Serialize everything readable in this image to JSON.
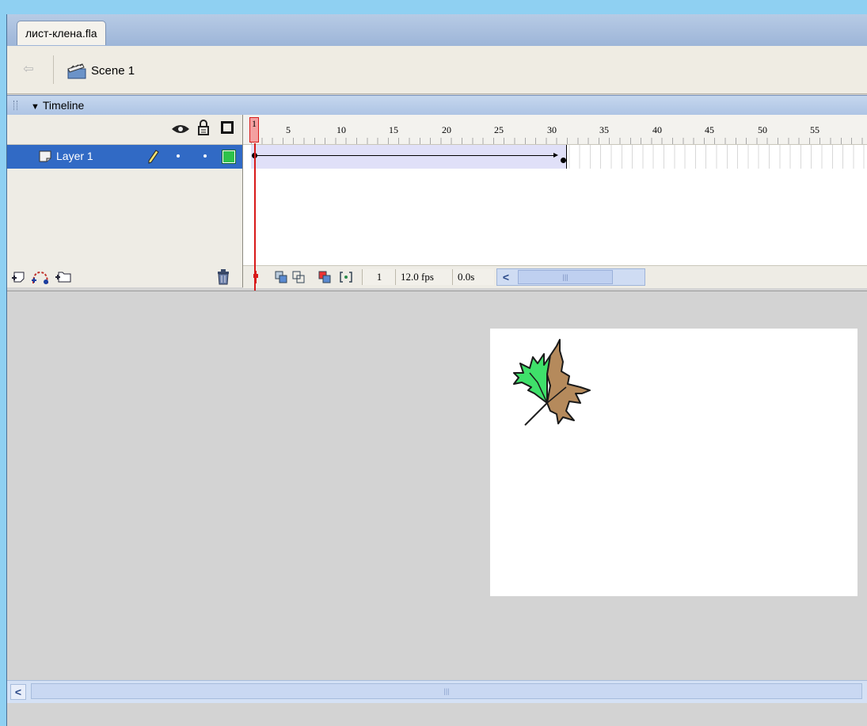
{
  "document": {
    "tab_label": "лист-клена.fla"
  },
  "scene": {
    "label": "Scene 1"
  },
  "timeline": {
    "panel_title": "Timeline",
    "ruler_numbers": [
      "1",
      "5",
      "10",
      "15",
      "20",
      "25",
      "30",
      "35",
      "40",
      "45",
      "50",
      "55"
    ],
    "layer": {
      "name": "Layer 1",
      "color": "#2ec24a"
    },
    "current_frame": "1",
    "frame_rate": "12.0 fps",
    "elapsed_time": "0.0s",
    "tween_start_frame": 1,
    "tween_end_frame": 30
  },
  "colors": {
    "selection": "#316ac5",
    "playhead": "#d81a1a",
    "leaf_green": "#3fe06a",
    "leaf_brown": "#b58a5c"
  }
}
